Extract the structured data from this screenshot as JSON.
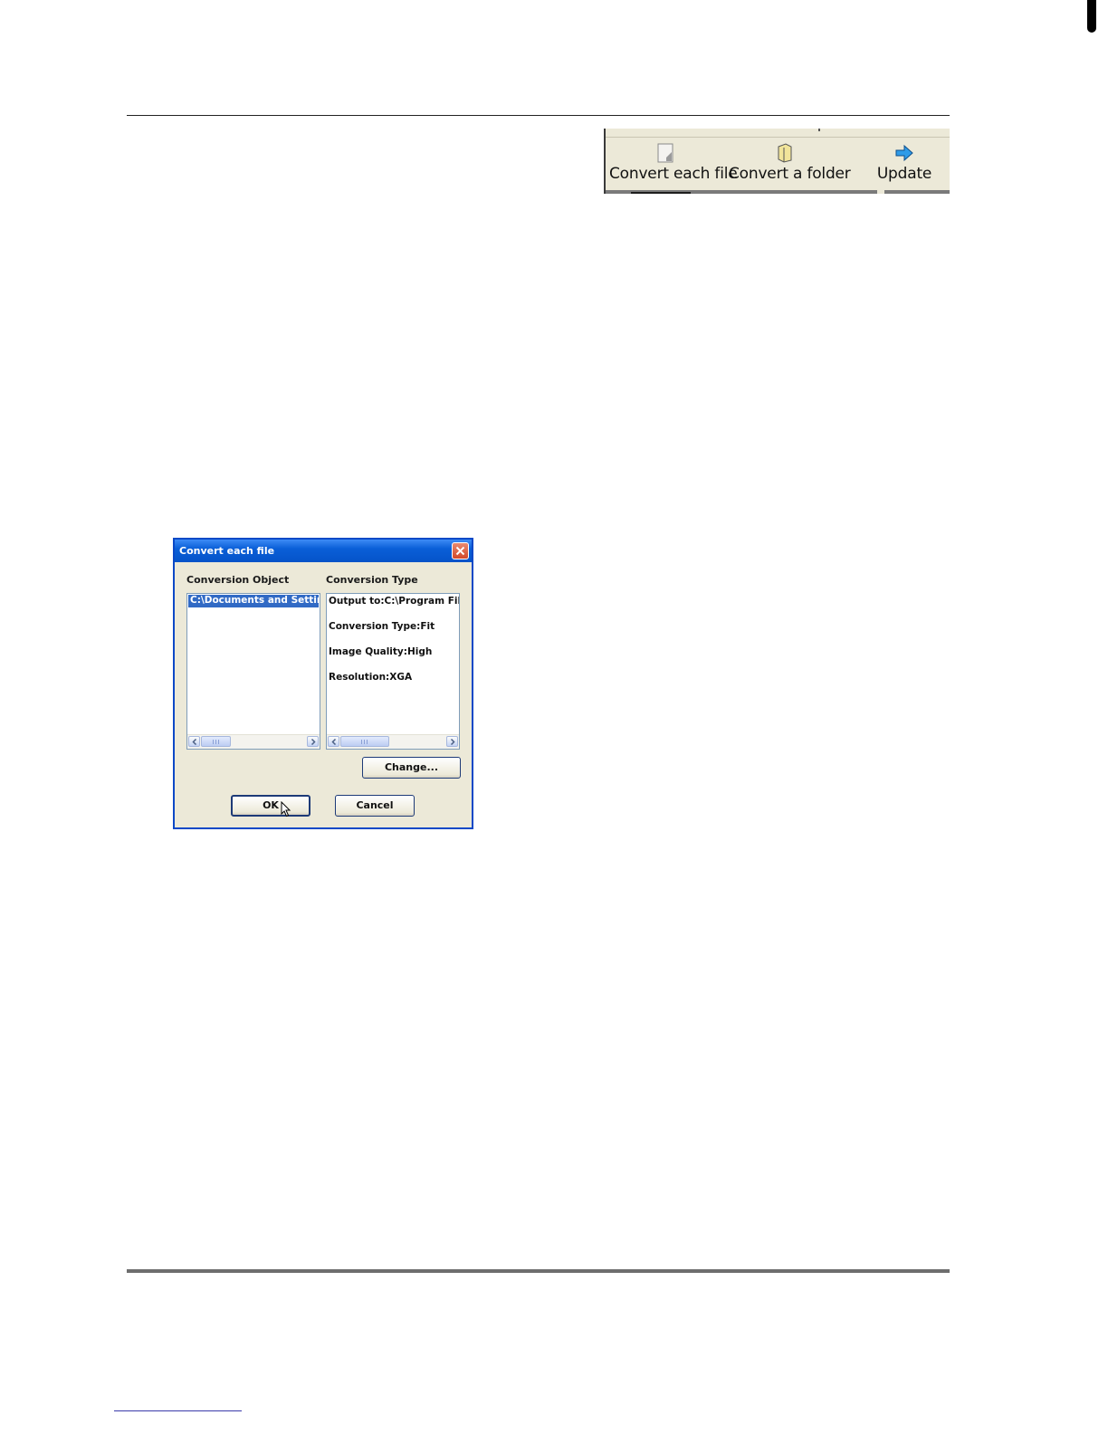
{
  "toolbar": {
    "buttons": [
      {
        "label": "Convert each file",
        "icon": "document-icon"
      },
      {
        "label": "Convert a folder",
        "icon": "folder-icon"
      },
      {
        "label": "Update",
        "icon": "arrow-right-icon"
      }
    ]
  },
  "dialog": {
    "title": "Convert each file",
    "conversion_object": {
      "header": "Conversion Object",
      "items": [
        "C:\\Documents and Settings"
      ]
    },
    "conversion_type": {
      "header": "Conversion Type",
      "lines": [
        "Output to:C:\\Program Files",
        "Conversion Type:Fit",
        "Image Quality:High",
        "Resolution:XGA"
      ]
    },
    "change_label": "Change...",
    "ok_label": "OK",
    "cancel_label": "Cancel"
  },
  "colors": {
    "titlebar": "#0a5fd8",
    "selection": "#316ac5",
    "dialog_bg": "#ece9d8"
  }
}
